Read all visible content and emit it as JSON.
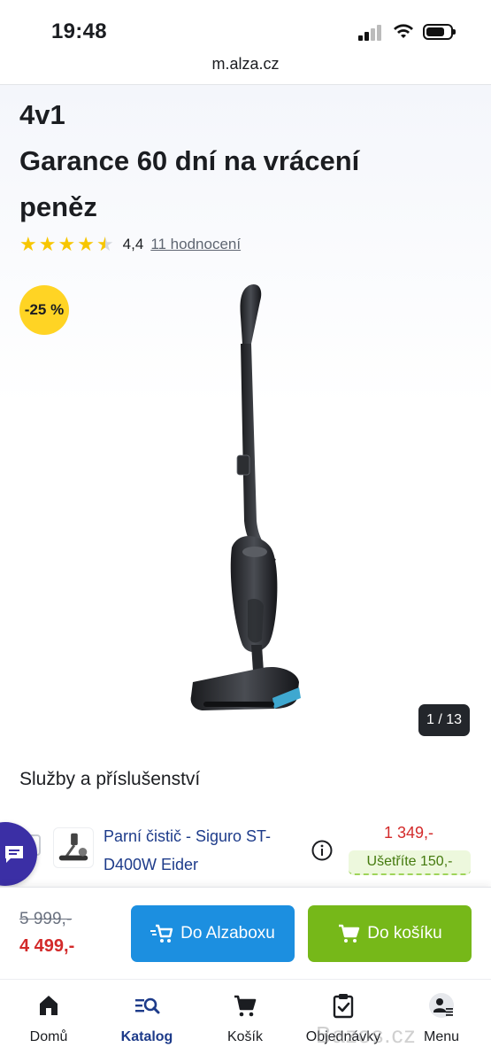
{
  "status_bar": {
    "time": "19:48"
  },
  "browser": {
    "url": "m.alza.cz"
  },
  "product": {
    "title_lines": [
      "4v1",
      "Garance 60 dní na vrácení",
      "peněz"
    ],
    "rating_value": "4,4",
    "rating_stars": 4.5,
    "rating_count": "11 hodnocení",
    "discount_badge": "-25 %",
    "gallery_counter": "1 / 13"
  },
  "services": {
    "section_title": "Služby a příslušenství",
    "items": [
      {
        "name": "Parní čistič - Siguro ST-D400W Eider",
        "price": "1 349,-",
        "savings": "Ušetříte 150,-"
      }
    ]
  },
  "purchase": {
    "old_price": "5 999,-",
    "new_price": "4 499,-",
    "alzabox_label": "Do Alzaboxu",
    "cart_label": "Do košíku"
  },
  "nav": {
    "items": [
      {
        "label": "Domů",
        "icon": "home-icon"
      },
      {
        "label": "Katalog",
        "icon": "catalog-search-icon",
        "active": true
      },
      {
        "label": "Košík",
        "icon": "cart-icon"
      },
      {
        "label": "Objednávky",
        "icon": "orders-clipboard-icon"
      },
      {
        "label": "Menu",
        "icon": "user-menu-icon"
      }
    ]
  },
  "watermark": "Bazos.cz",
  "colors": {
    "price_red": "#d32a2a",
    "alzabox_blue": "#1c8fe0",
    "cart_green": "#76b819",
    "badge_yellow": "#ffd424",
    "link_blue": "#1d3b8a"
  }
}
